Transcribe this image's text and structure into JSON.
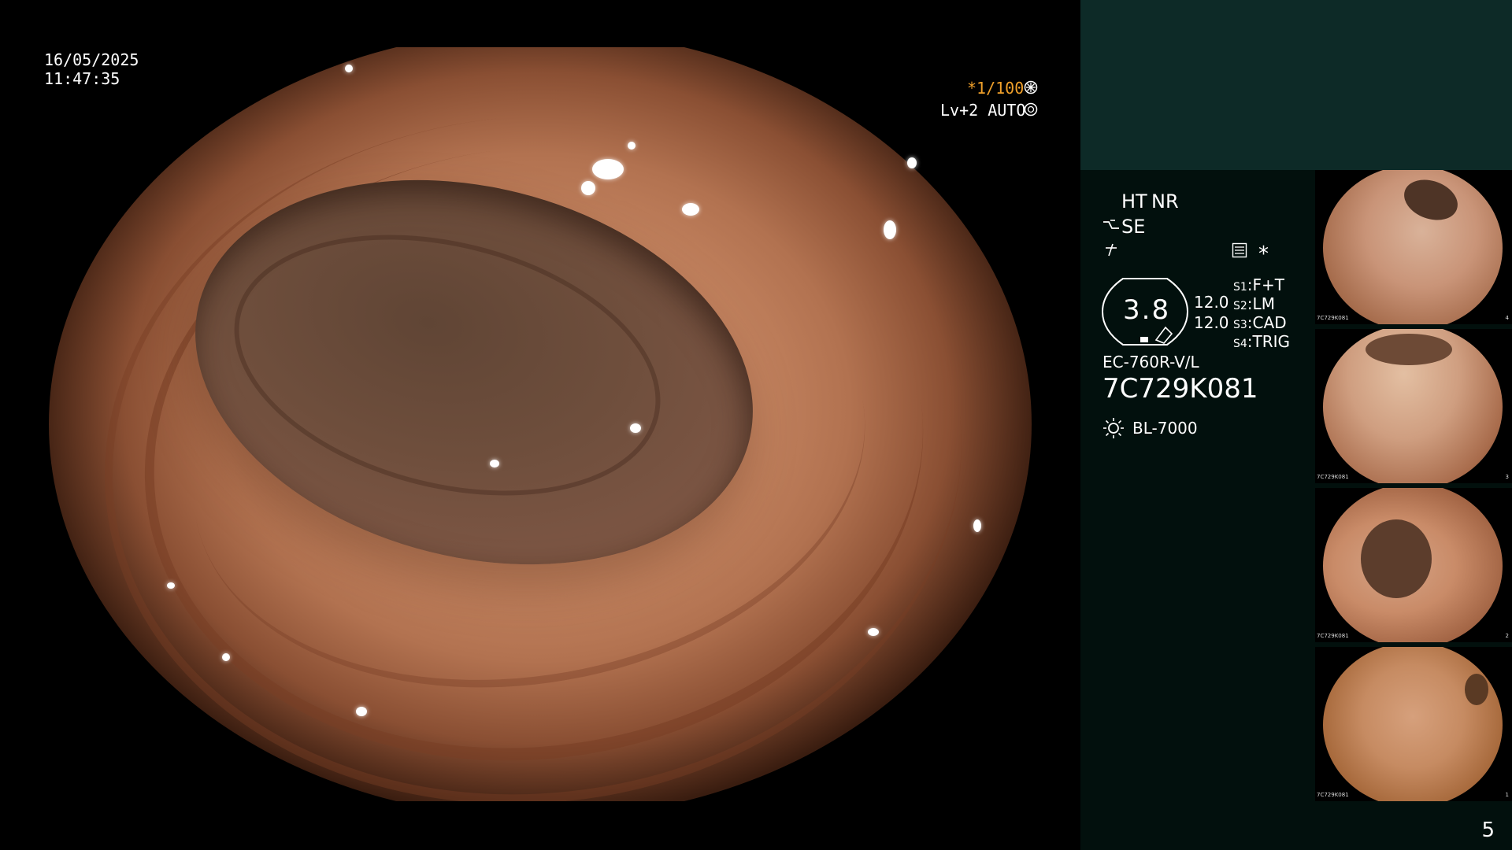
{
  "overlay": {
    "date": "16/05/2025",
    "time": "11:47:35",
    "shutter": "*1/100",
    "brightness": "Lv+2 AUTO"
  },
  "info_panel": {
    "ht": "HT",
    "nr": "NR",
    "se": "SE",
    "zoom_value": "3.8",
    "scale_top": "12.0",
    "scale_bottom": "12.0",
    "asterisk": "*",
    "settings": [
      {
        "key": "S1",
        "value": "F+T"
      },
      {
        "key": "S2",
        "value": "LM"
      },
      {
        "key": "S3",
        "value": "CAD"
      },
      {
        "key": "S4",
        "value": "TRIG"
      }
    ],
    "scope_model": "EC-760R-V/L",
    "serial": "7C729K081",
    "light_source": "BL-7000"
  },
  "thumbnails": [
    {
      "code": "7C729K081",
      "number": "4"
    },
    {
      "code": "7C729K081",
      "number": "3"
    },
    {
      "code": "7C729K081",
      "number": "2"
    },
    {
      "code": "7C729K081",
      "number": "1"
    }
  ],
  "page_number": "5",
  "colors": {
    "accent": "#f0a02a",
    "panel_top": "#0d2a27",
    "panel_bg": "#02100d"
  },
  "icons": [
    "aperture-icon",
    "auto-iris-icon",
    "enhance-icon",
    "freeze-icon",
    "memo-icon",
    "light-source-icon"
  ]
}
